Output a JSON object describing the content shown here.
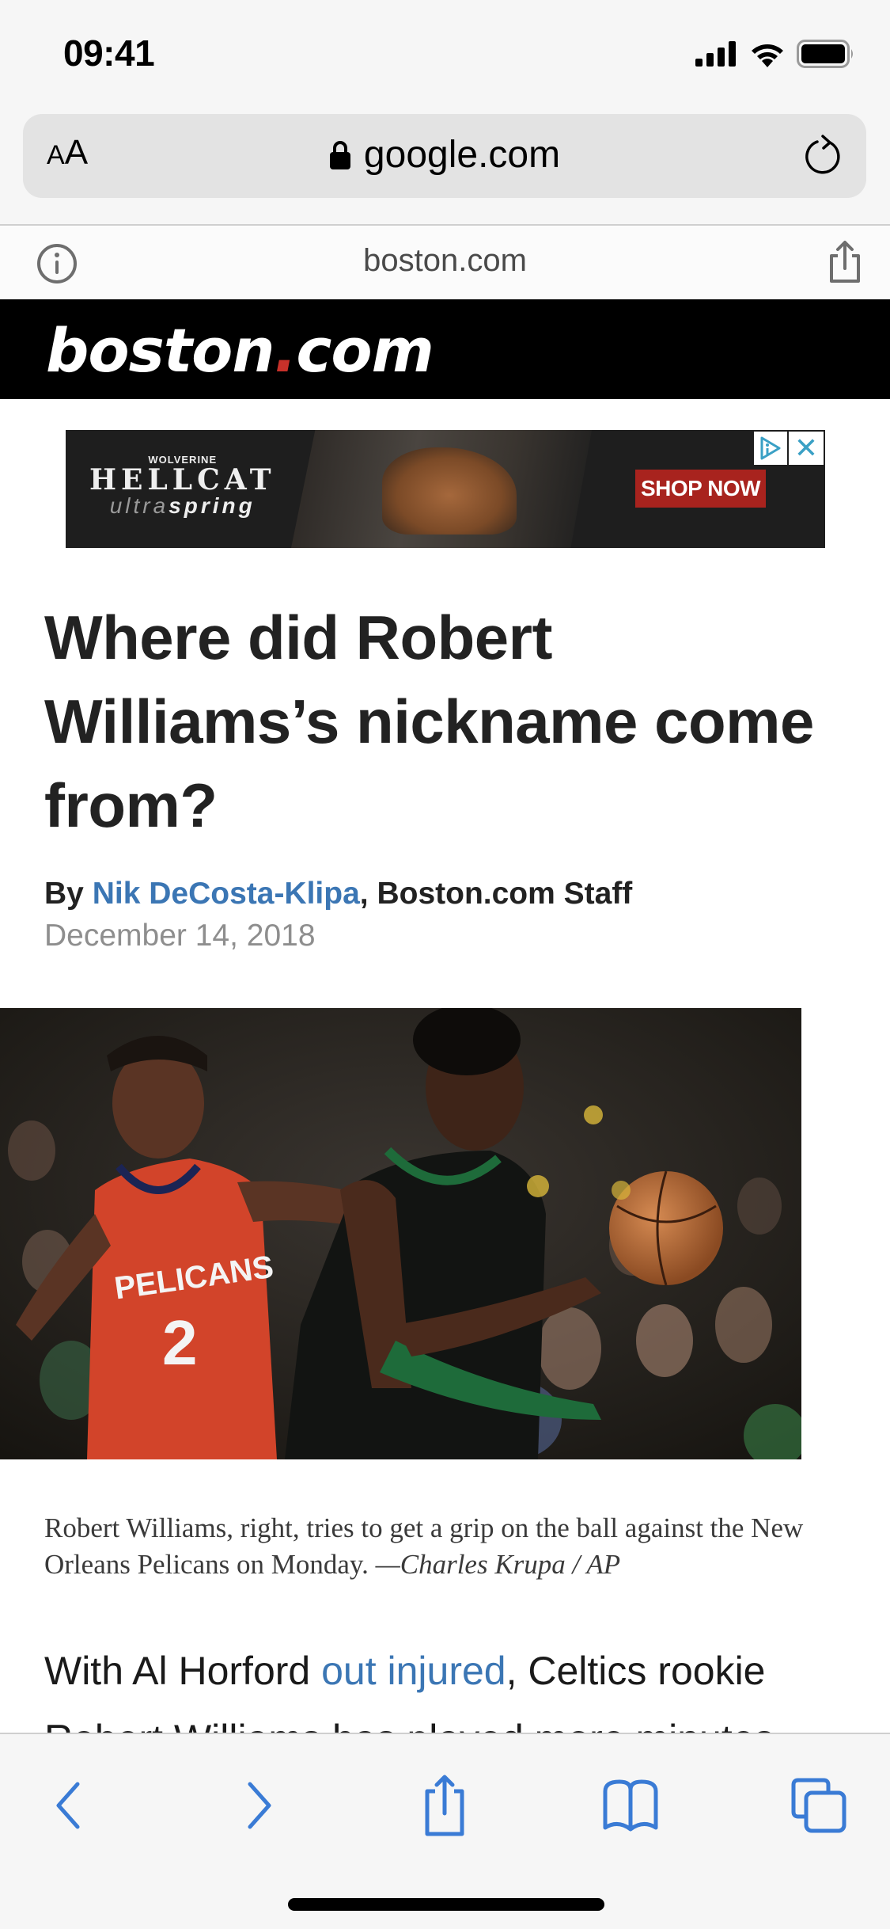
{
  "status_bar": {
    "time": "09:41",
    "icons": [
      "cellular-signal-icon",
      "wifi-icon",
      "battery-icon"
    ]
  },
  "browser": {
    "text_size_label_small": "A",
    "text_size_label_big": "A",
    "url": "google.com",
    "secure": true,
    "site_domain": "boston.com"
  },
  "site": {
    "logo_part1": "boston",
    "logo_dot": ".",
    "logo_part2": "com",
    "accent_color": "#c8312a"
  },
  "ad": {
    "brand_small": "WOLVERINE",
    "brand_big": "HELLCAT",
    "brand_sub_light": "ultra",
    "brand_sub_bold": "spring",
    "cta": "SHOP NOW",
    "close_label": "✕"
  },
  "article": {
    "headline": "Where did Robert Williams’s nickname come from?",
    "byline_prefix": "By ",
    "author": "Nik DeCosta-Klipa",
    "byline_suffix": ", Boston.com Staff",
    "date": "December 14, 2018",
    "photo_alt": "Robert Williams and a New Orleans Pelicans player reaching for the ball",
    "caption": "Robert Williams, right, tries to get a grip on the ball against the New Orleans Pelicans on Monday. ",
    "caption_credit": "—Charles Krupa / AP",
    "body_prefix": "With Al Horford ",
    "body_link": "out injured",
    "body_suffix": ", Celtics rookie Robert Williams has played more minutes",
    "link_color": "#3b76b4"
  },
  "toolbar": {
    "buttons": [
      "back",
      "forward",
      "share",
      "bookmarks",
      "tabs"
    ],
    "tint": "#3a7bd5"
  }
}
